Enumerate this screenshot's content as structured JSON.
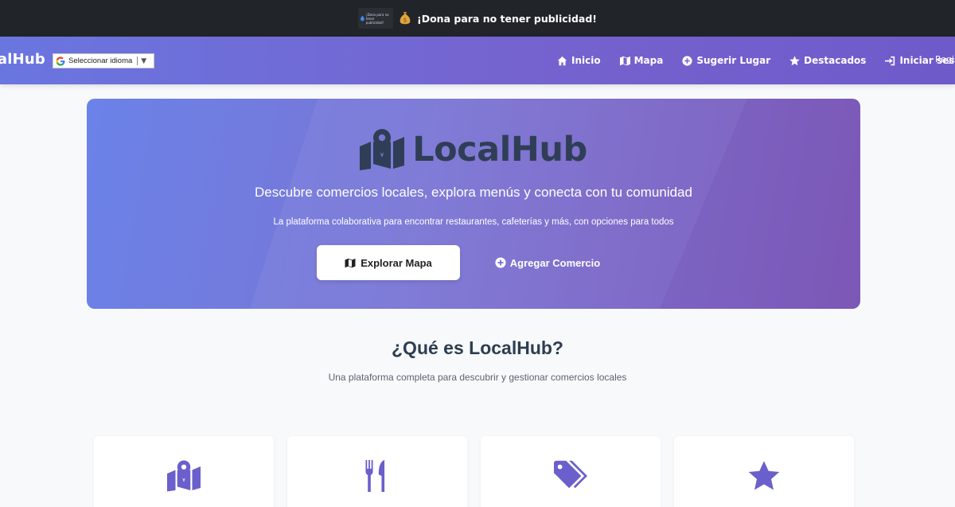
{
  "donation": {
    "badge_text": "¡Dona para no tener publicidad!",
    "text": "¡Dona para no tener publicidad!"
  },
  "navbar": {
    "brand": "LocalHub",
    "brand_visible": "calHub",
    "language_selector": "Seleccionar idioma",
    "links": [
      {
        "label": "Inicio",
        "icon": "home-icon"
      },
      {
        "label": "Mapa",
        "icon": "map-icon"
      },
      {
        "label": "Sugerir Lugar",
        "icon": "plus-circle-icon"
      },
      {
        "label": "Destacados",
        "icon": "star-icon"
      },
      {
        "label": "Iniciar sesión",
        "icon": "sign-in-icon"
      }
    ],
    "register_partial": "Regis"
  },
  "hero": {
    "title": "LocalHub",
    "subtitle": "Descubre comercios locales, explora menús y conecta con tu comunidad",
    "description": "La plataforma colaborativa para encontrar restaurantes, cafeterías y más, con opciones para todos",
    "primary_button": "Explorar Mapa",
    "secondary_button": "Agregar Comercio"
  },
  "section": {
    "title": "¿Qué es LocalHub?",
    "subtitle": "Una plataforma completa para descubrir y gestionar comercios locales"
  },
  "features": [
    {
      "icon": "map-location-icon"
    },
    {
      "icon": "utensils-icon"
    },
    {
      "icon": "tags-icon"
    },
    {
      "icon": "star-icon"
    }
  ],
  "colors": {
    "donate_bar": "#212529",
    "nav_gradient_start": "#6a76e0",
    "nav_gradient_end": "#6f5ac9",
    "hero_gradient_start": "#6b82e8",
    "hero_gradient_end": "#7a55b8",
    "hero_title": "#2f3e56",
    "feature_icon": "#6a5fcb",
    "background": "#f8f9fb"
  }
}
